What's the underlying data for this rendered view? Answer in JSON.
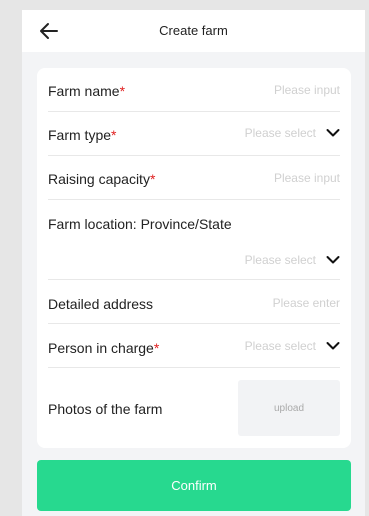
{
  "header": {
    "title": "Create farm",
    "back_icon": "arrow-left-icon"
  },
  "form": {
    "farm_name": {
      "label": "Farm name",
      "required_mark": "*",
      "placeholder": "Please input"
    },
    "farm_type": {
      "label": "Farm type",
      "required_mark": "*",
      "placeholder": "Please select"
    },
    "raising_capacity": {
      "label": "Raising capacity",
      "required_mark": "*",
      "placeholder": "Please input"
    },
    "farm_location": {
      "label": "Farm location: Province/State",
      "placeholder": "Please select"
    },
    "detailed_address": {
      "label": "Detailed address",
      "placeholder": "Please enter"
    },
    "person_in_charge": {
      "label": "Person in charge",
      "required_mark": "*",
      "placeholder": "Please select"
    },
    "photos": {
      "label": "Photos of the farm",
      "upload_label": "upload"
    }
  },
  "confirm_label": "Confirm",
  "colors": {
    "accent": "#27d98f",
    "required": "#e02020",
    "placeholder": "#d0d0d0"
  }
}
